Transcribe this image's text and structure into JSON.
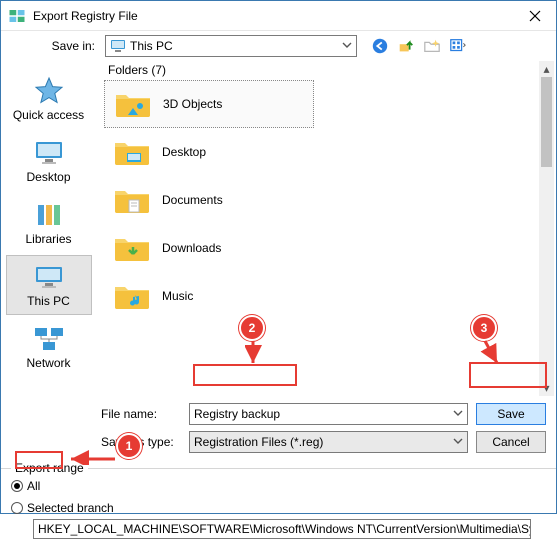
{
  "window": {
    "title": "Export Registry File"
  },
  "toolbar": {
    "savein_label": "Save in:",
    "savein_value": "This PC"
  },
  "sidebar": [
    {
      "key": "quick",
      "label": "Quick access"
    },
    {
      "key": "desktop",
      "label": "Desktop"
    },
    {
      "key": "libraries",
      "label": "Libraries"
    },
    {
      "key": "thispc",
      "label": "This PC",
      "selected": true
    },
    {
      "key": "network",
      "label": "Network"
    }
  ],
  "content": {
    "group_header": "Folders (7)",
    "items": [
      {
        "name": "3D Objects",
        "selected": true,
        "accent": "#2aa9e0"
      },
      {
        "name": "Desktop",
        "accent": "#2aa9e0"
      },
      {
        "name": "Documents",
        "accent": "#ffffff"
      },
      {
        "name": "Downloads",
        "accent": "#49b04a"
      },
      {
        "name": "Music",
        "accent": "#2aa9e0"
      }
    ]
  },
  "filefields": {
    "filename_label": "File name:",
    "filename_value": "Registry backup",
    "type_label": "Save as type:",
    "type_value": "Registration Files (*.reg)",
    "save_label": "Save",
    "cancel_label": "Cancel"
  },
  "range": {
    "group_label": "Export range",
    "all_label": "All",
    "branch_label": "Selected branch",
    "selected": "all",
    "branch_value": "HKEY_LOCAL_MACHINE\\SOFTWARE\\Microsoft\\Windows NT\\CurrentVersion\\Multimedia\\SystemProfile"
  },
  "annotations": {
    "a1": "1",
    "a2": "2",
    "a3": "3"
  }
}
